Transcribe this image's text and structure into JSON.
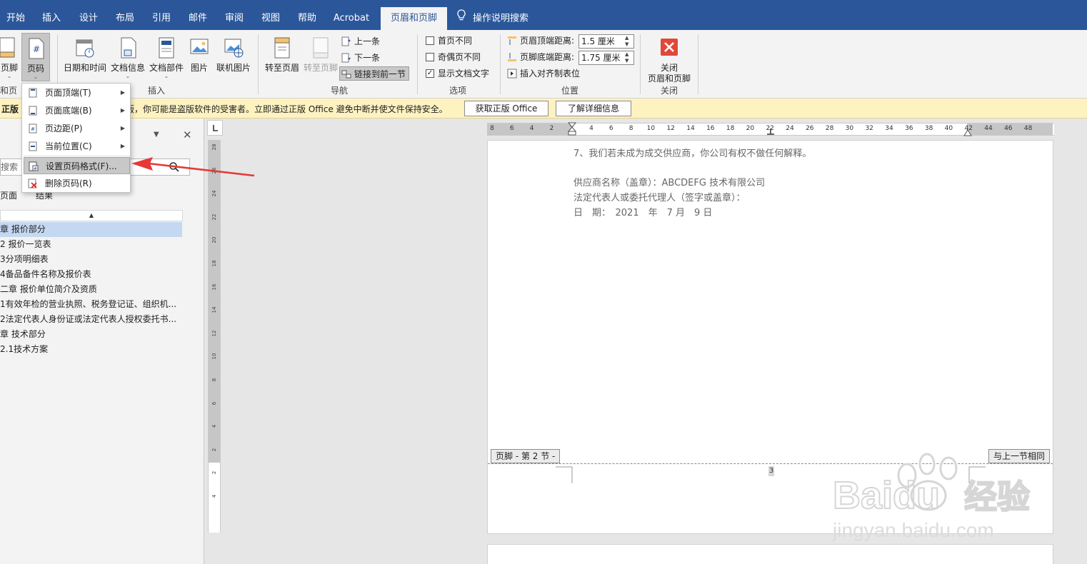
{
  "tabs": {
    "items": [
      {
        "label": "开始"
      },
      {
        "label": "插入"
      },
      {
        "label": "设计"
      },
      {
        "label": "布局"
      },
      {
        "label": "引用"
      },
      {
        "label": "邮件"
      },
      {
        "label": "审阅"
      },
      {
        "label": "视图"
      },
      {
        "label": "帮助"
      },
      {
        "label": "Acrobat"
      },
      {
        "label": "页眉和页脚"
      }
    ],
    "active": "页眉和页脚",
    "tell_me": "操作说明搜索"
  },
  "ribbon": {
    "footer_btn": "页脚",
    "page_number_btn": "页码",
    "group1_label": "和页脚",
    "datetime_btn": "日期和时间",
    "docinfo_btn": "文档信息",
    "quickparts_btn": "文档部件",
    "picture_btn": "图片",
    "online_picture_btn": "联机图片",
    "insert_group": "插入",
    "goto_header_btn": "转至页眉",
    "goto_footer_btn": "转至页脚",
    "prev_btn": "上一条",
    "next_btn": "下一条",
    "link_prev_btn": "链接到前一节",
    "nav_group": "导航",
    "opt_first": "首页不同",
    "opt_oddeven": "奇偶页不同",
    "opt_showtext": "显示文档文字",
    "options_group": "选项",
    "header_top_label": "页眉顶端距离:",
    "header_top_value": "1.5 厘米",
    "footer_bottom_label": "页脚底端距离:",
    "footer_bottom_value": "1.75 厘米",
    "align_tab_btn": "插入对齐制表位",
    "position_group": "位置",
    "close_line1": "关闭",
    "close_line2": "页眉和页脚",
    "close_group": "关闭"
  },
  "notify": {
    "badge": "正版",
    "message": "版，你可能是盗版软件的受害者。立即通过正版 Office 避免中断并使文件保持安全。",
    "btn_get": "获取正版 Office",
    "btn_learn": "了解详细信息"
  },
  "nav": {
    "search_placeholder": "搜索",
    "tab_pages": "页面",
    "tab_results": "结果",
    "items": [
      {
        "label": "章 报价部分"
      },
      {
        "label": "2 报价一览表"
      },
      {
        "label": "3分项明细表"
      },
      {
        "label": "4备品备件名称及报价表"
      },
      {
        "label": "二章 报价单位简介及资质"
      },
      {
        "label": "1有效年检的营业执照、税务登记证、组织机..."
      },
      {
        "label": "2法定代表人身份证或法定代表人授权委托书..."
      },
      {
        "label": "章 技术部分"
      },
      {
        "label": "2.1技术方案"
      }
    ]
  },
  "menu": {
    "items": [
      {
        "label": "页面顶端(T)"
      },
      {
        "label": "页面底端(B)"
      },
      {
        "label": "页边距(P)"
      },
      {
        "label": "当前位置(C)"
      },
      {
        "label": "设置页码格式(F)..."
      },
      {
        "label": "删除页码(R)"
      }
    ]
  },
  "rulers": {
    "horizontal": [
      "8",
      "6",
      "4",
      "2",
      "2",
      "4",
      "6",
      "8",
      "10",
      "12",
      "14",
      "16",
      "18",
      "20",
      "22",
      "24",
      "26",
      "28",
      "30",
      "32",
      "34",
      "36",
      "38",
      "40",
      "42",
      "44",
      "46",
      "48"
    ],
    "vertical": [
      "28",
      "26",
      "24",
      "22",
      "20",
      "18",
      "16",
      "14",
      "12",
      "10",
      "8",
      "6",
      "4",
      "2",
      "2",
      "4"
    ]
  },
  "document": {
    "lines": [
      "7、我们若未成为成交供应商，你公司有权不做任何解释。",
      "供应商名称（盖章）：ABCDEFG 技术有限公司",
      "法定代表人或委托代理人（签字或盖章）：",
      "日　期：　2021　年　7 月　9 日"
    ],
    "footer_tag": "页脚 - 第 2 节 -",
    "same_as_prev": "与上一节相同",
    "page_number": "3"
  },
  "watermark": {
    "brand": "Baidu",
    "brand_cn": "经验",
    "url": "jingyan.baidu.com"
  },
  "colors": {
    "accent": "#2b579a",
    "ribbon_bg": "#f3f3f3",
    "notify_bg": "#fdf2c0",
    "selection": "#c5d8f1",
    "annotation_red": "#e53935"
  }
}
